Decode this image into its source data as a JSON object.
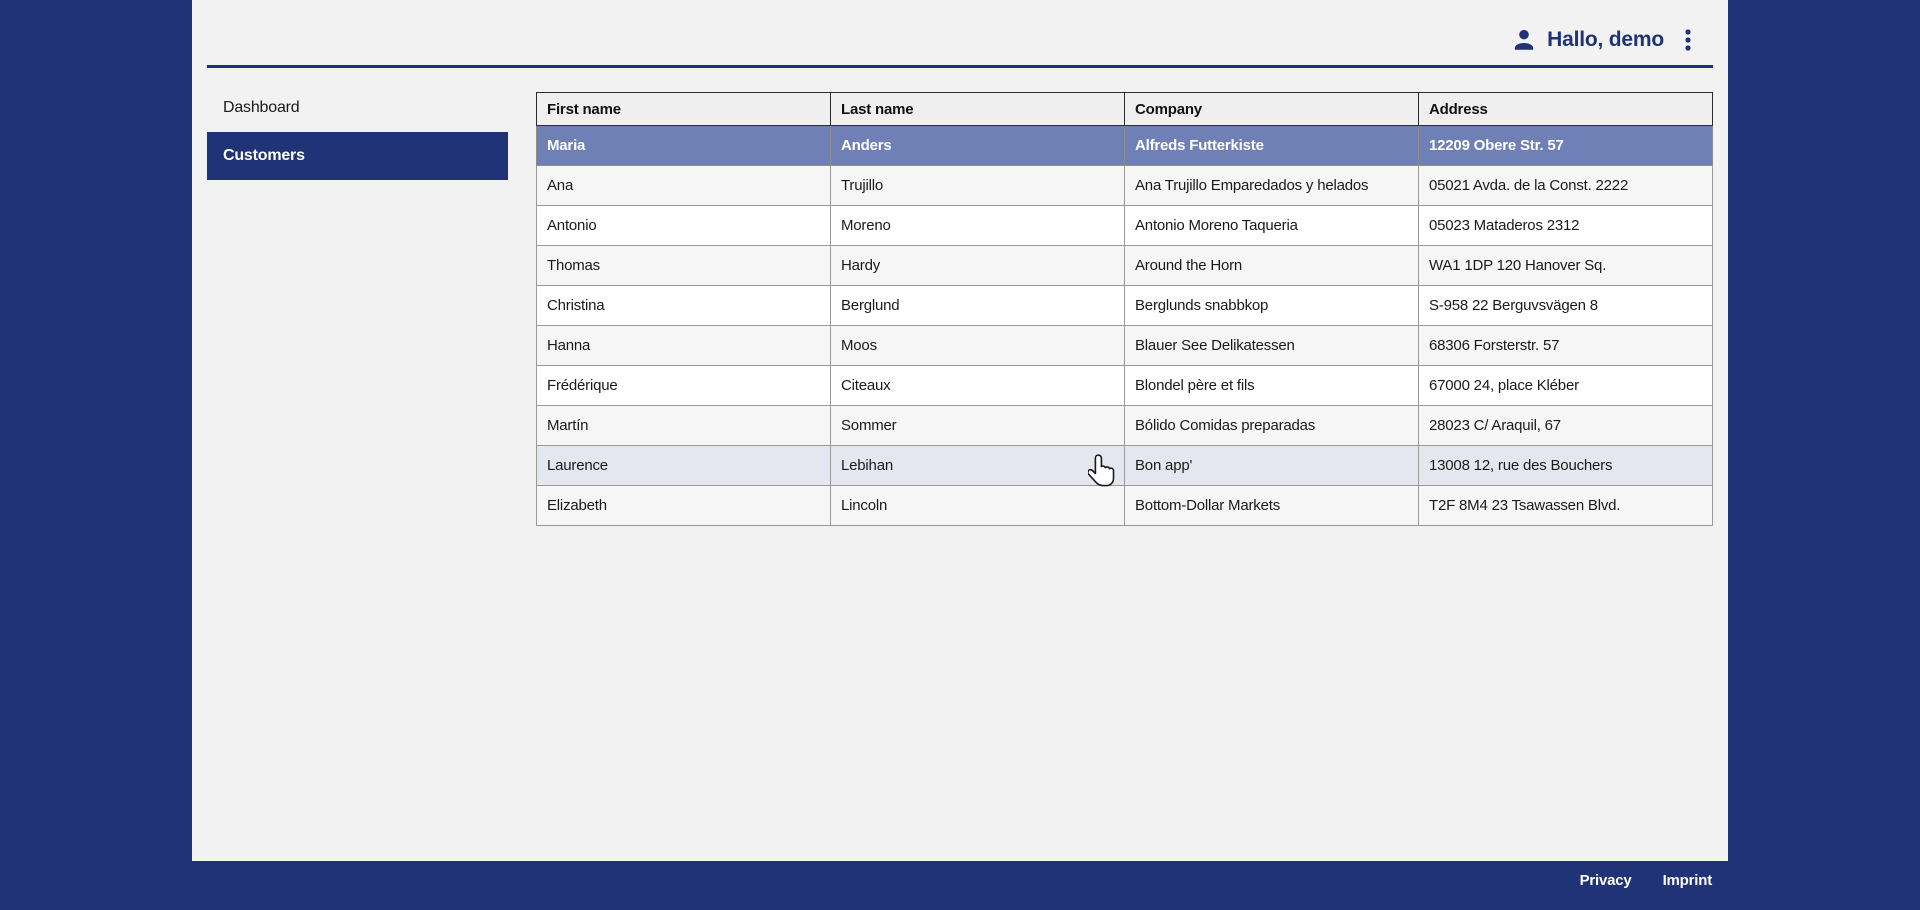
{
  "header": {
    "greeting": "Hallo, demo"
  },
  "sidebar": {
    "items": [
      {
        "label": "Dashboard",
        "active": false
      },
      {
        "label": "Customers",
        "active": true
      }
    ]
  },
  "table": {
    "columns": [
      "First name",
      "Last name",
      "Company",
      "Address"
    ],
    "rows": [
      {
        "first": "Maria",
        "last": "Anders",
        "company": "Alfreds Futterkiste",
        "address": "12209 Obere Str. 57",
        "state": "selected"
      },
      {
        "first": "Ana",
        "last": "Trujillo",
        "company": "Ana Trujillo Emparedados y helados",
        "address": "05021 Avda. de la Const. 2222",
        "state": "stripe"
      },
      {
        "first": "Antonio",
        "last": "Moreno",
        "company": "Antonio Moreno Taqueria",
        "address": "05023 Mataderos 2312",
        "state": "plain"
      },
      {
        "first": "Thomas",
        "last": "Hardy",
        "company": "Around the Horn",
        "address": "WA1 1DP 120 Hanover Sq.",
        "state": "stripe"
      },
      {
        "first": "Christina",
        "last": "Berglund",
        "company": "Berglunds snabbkop",
        "address": "S-958 22 Berguvsvägen 8",
        "state": "plain"
      },
      {
        "first": "Hanna",
        "last": "Moos",
        "company": "Blauer See Delikatessen",
        "address": "68306 Forsterstr. 57",
        "state": "stripe"
      },
      {
        "first": "Frédérique",
        "last": "Citeaux",
        "company": "Blondel père et fils",
        "address": "67000 24, place Kléber",
        "state": "plain"
      },
      {
        "first": "Martín",
        "last": "Sommer",
        "company": "Bólido Comidas preparadas",
        "address": "28023 C/ Araquil, 67",
        "state": "stripe"
      },
      {
        "first": "Laurence",
        "last": "Lebihan",
        "company": "Bon app'",
        "address": "13008 12, rue des Bouchers",
        "state": "hover"
      },
      {
        "first": "Elizabeth",
        "last": "Lincoln",
        "company": "Bottom-Dollar Markets",
        "address": "T2F 8M4 23 Tsawassen Blvd.",
        "state": "stripe"
      }
    ]
  },
  "footer": {
    "links": [
      "Privacy",
      "Imprint"
    ]
  },
  "icons": {
    "user": "person-icon",
    "menu": "kebab-menu-icon",
    "pointer": "hand-cursor"
  },
  "colors": {
    "brand": "#1f3376",
    "content_background": "#f2f2f3",
    "selected_row": "#6e80b5",
    "hover_row": "#e4e7f0",
    "stripe_row": "#f6f6f6",
    "header_cell": "#efefef"
  }
}
